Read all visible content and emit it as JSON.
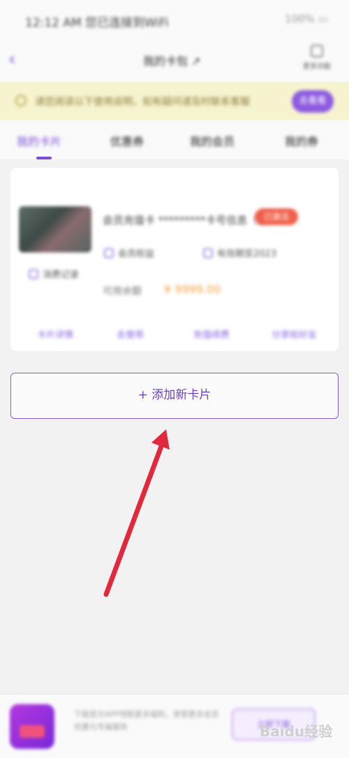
{
  "status_bar": {
    "left_text": "12:12 AM 您已连接到WiFi",
    "right_text": "100% ▭"
  },
  "nav": {
    "title": "我的卡包 ↗",
    "right_label": "更多功能"
  },
  "notice": {
    "text": "请您阅读以下使用说明，如有疑问请及时联系客服",
    "button": "去看看"
  },
  "tabs": [
    {
      "label": "我的卡片"
    },
    {
      "label": "优惠券"
    },
    {
      "label": "我的会员"
    },
    {
      "label": "我的券"
    }
  ],
  "card": {
    "title": "会员充值卡 *********卡号信息（1",
    "badge": "已激活",
    "meta1": "会员权益",
    "meta2": "有效期至2023",
    "meta3": "消费记录",
    "price_label": "可用余额",
    "price_value": "¥ 9999.00",
    "actions": [
      "卡片详情",
      "去使用",
      "充值续费",
      "分享给好友"
    ]
  },
  "add_card_button": "+ 添加新卡片",
  "bottom": {
    "text": "下载官方APP领取更多福利，享受更多会员优惠与专属服务",
    "button": "立即下载",
    "watermark": "Baidu经验"
  },
  "colors": {
    "accent": "#7d4fd2",
    "arrow": "#e0293d",
    "badge": "#f05f4a"
  }
}
